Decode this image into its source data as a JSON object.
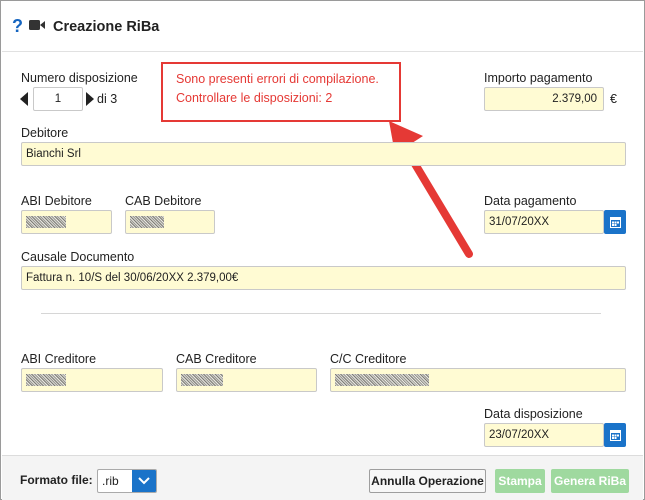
{
  "header": {
    "help_glyph": "?",
    "title": "Creazione RiBa"
  },
  "numero": {
    "label": "Numero disposizione",
    "value": "1",
    "of_text": "di 3"
  },
  "error": {
    "line1": "Sono presenti errori di compilazione.",
    "line2": "Controllare le disposizioni: 2",
    "color": "#e53935"
  },
  "importo": {
    "label": "Importo pagamento",
    "value": "2.379,00",
    "currency": "€"
  },
  "debitore": {
    "label": "Debitore",
    "value": "Bianchi Srl"
  },
  "abi_debitore": {
    "label": "ABI Debitore"
  },
  "cab_debitore": {
    "label": "CAB Debitore"
  },
  "data_pagamento": {
    "label": "Data pagamento",
    "value": "31/07/20XX"
  },
  "causale": {
    "label": "Causale Documento",
    "value": "Fattura n. 10/S del 30/06/20XX 2.379,00€"
  },
  "abi_creditore": {
    "label": "ABI Creditore"
  },
  "cab_creditore": {
    "label": "CAB Creditore"
  },
  "cc_creditore": {
    "label": "C/C Creditore"
  },
  "data_disposizione": {
    "label": "Data disposizione",
    "value": "23/07/20XX"
  },
  "footer": {
    "formato_label": "Formato file:",
    "formato_value": ".rib",
    "annulla_label": "Annulla Operazione",
    "stampa_label": "Stampa",
    "genera_label": "Genera RiBa"
  },
  "colors": {
    "accent": "#1a73c9",
    "field_bg": "#fffbd3",
    "arrow": "#e53935",
    "disabled_green": "#9fd99f"
  }
}
